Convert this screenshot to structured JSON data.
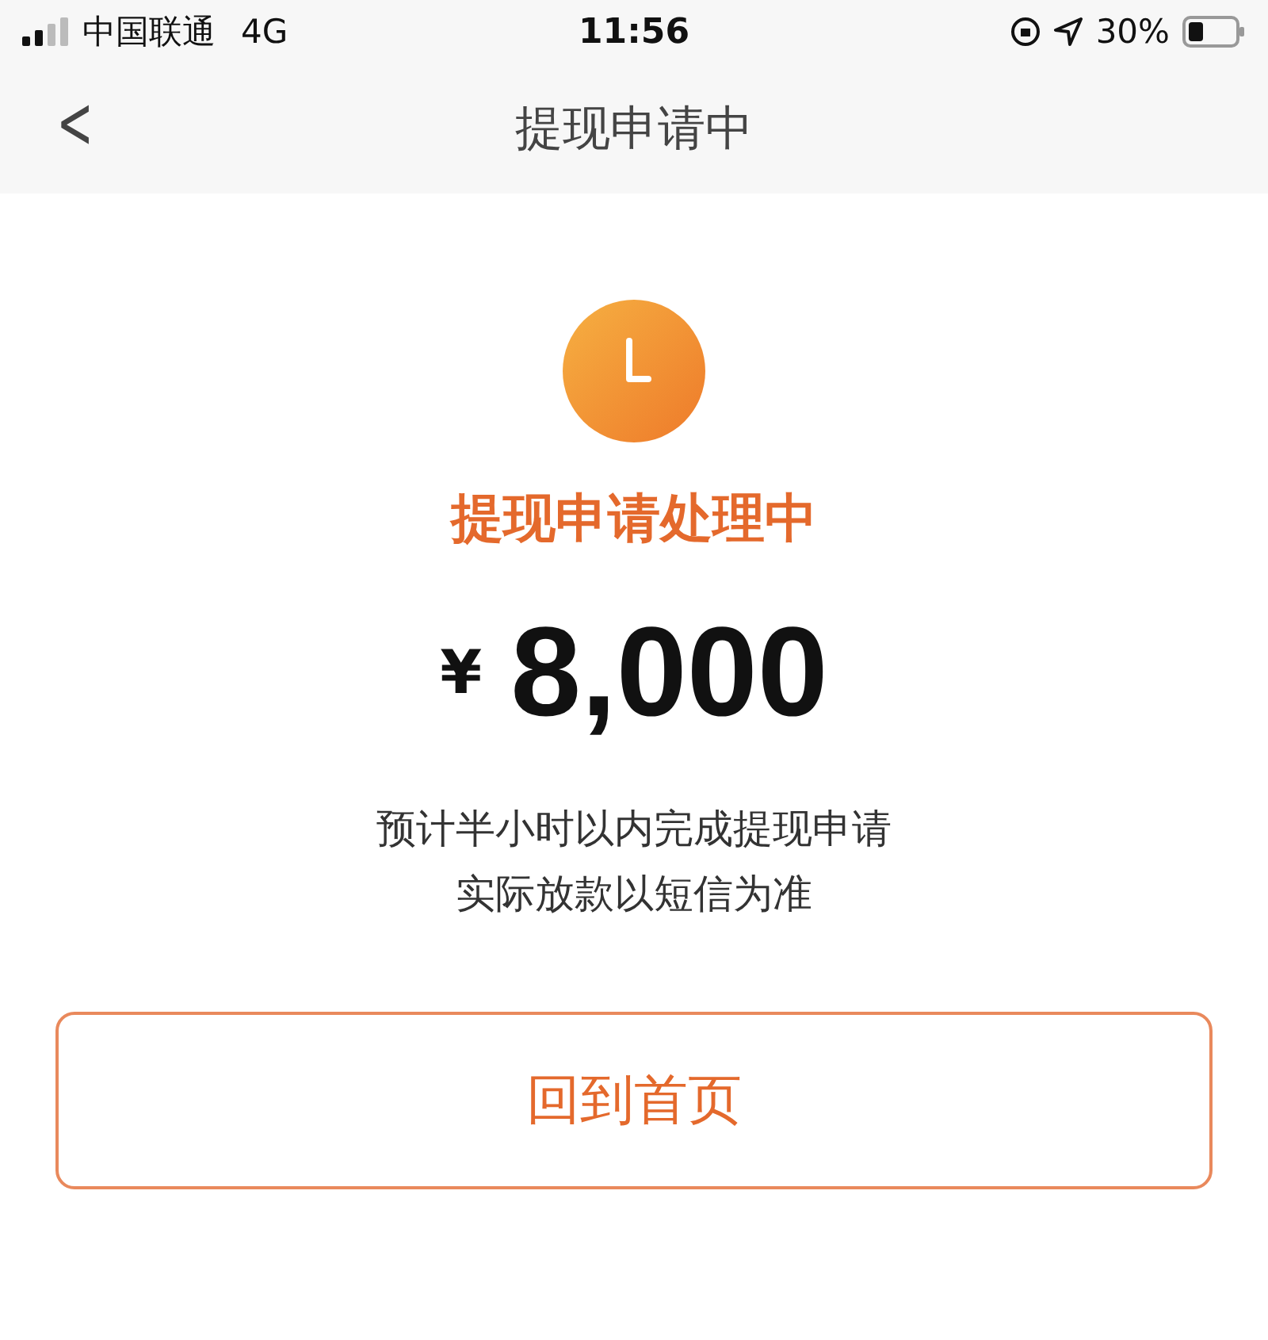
{
  "status_bar": {
    "carrier": "中国联通",
    "network": "4G",
    "time": "11:56",
    "battery": "30%"
  },
  "nav": {
    "back": "<",
    "title": "提现申请中"
  },
  "result": {
    "status": "提现申请处理中",
    "currency": "¥",
    "amount": "8,000",
    "notes": [
      "预计半小时以内完成提现申请",
      "实际放款以短信为准"
    ]
  },
  "button": "回到首页"
}
